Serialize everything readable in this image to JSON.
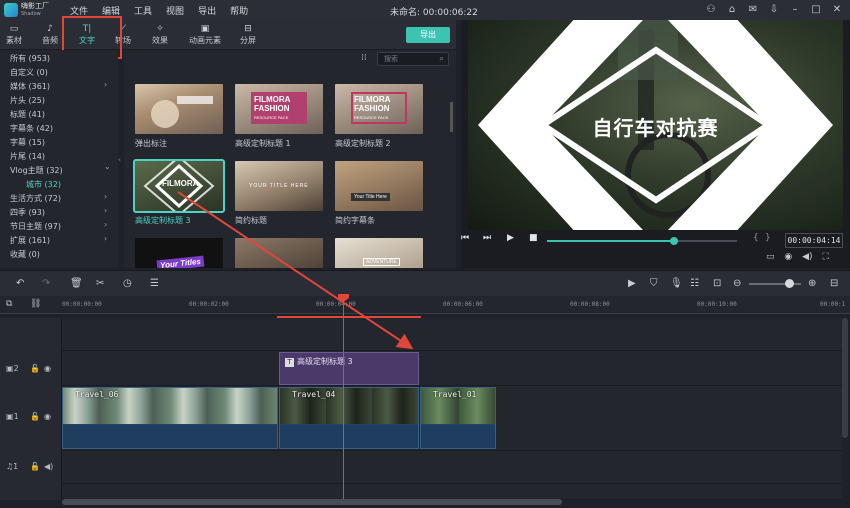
{
  "app": {
    "logo_line1": "嗨影工厂",
    "logo_line2": "Shadow",
    "doc_title": "未命名: 00:00:06:22",
    "menu": [
      "文件",
      "编辑",
      "工具",
      "视图",
      "导出",
      "帮助"
    ]
  },
  "tabs": [
    {
      "label": "素材",
      "icon": "folder-icon"
    },
    {
      "label": "音频",
      "icon": "music-icon"
    },
    {
      "label": "文字",
      "icon": "text-icon",
      "active": true
    },
    {
      "label": "转场",
      "icon": "transition-icon"
    },
    {
      "label": "效果",
      "icon": "effects-icon"
    },
    {
      "label": "动画元素",
      "icon": "image-icon"
    },
    {
      "label": "分屏",
      "icon": "split-screen-icon"
    }
  ],
  "export_label": "导出",
  "search_placeholder": "搜索",
  "sidebar": {
    "items": [
      {
        "label": "所有 (953)"
      },
      {
        "label": "自定义 (0)"
      },
      {
        "label": "媒体 (361)",
        "arrow": "›"
      },
      {
        "label": "片头 (25)"
      },
      {
        "label": "标题 (41)"
      },
      {
        "label": "字幕条 (42)"
      },
      {
        "label": "字幕 (15)"
      },
      {
        "label": "片尾 (14)"
      },
      {
        "label": "Vlog主题 (32)",
        "arrow": "⌄"
      },
      {
        "label": "城市 (32)",
        "sub": true
      },
      {
        "label": "生活方式 (72)",
        "arrow": "›"
      },
      {
        "label": "四季 (93)",
        "arrow": "›"
      },
      {
        "label": "节日主题 (97)",
        "arrow": "›"
      },
      {
        "label": "扩展 (161)",
        "arrow": "›"
      },
      {
        "label": "收藏 (0)"
      }
    ]
  },
  "thumbnails": [
    {
      "label": "弹出标注"
    },
    {
      "label": "高级定制标题 1",
      "text1": "FILMORA",
      "text2": "FASHION",
      "text3": "RESOURCE PACK"
    },
    {
      "label": "高级定制标题 2",
      "text1": "FILMORA",
      "text2": "FASHION",
      "text3": "RESOURCE PACK"
    },
    {
      "label": "高级定制标题 3",
      "text1": "FILMORA",
      "selected": true
    },
    {
      "label": "简约标题",
      "text1": "YOUR TITLE HERE"
    },
    {
      "label": "简约字幕条",
      "text1": "Your Title Here"
    },
    {
      "label": "",
      "text1": "Your Titles"
    },
    {
      "label": ""
    },
    {
      "label": "",
      "text1": "ADVENTURE"
    }
  ],
  "preview": {
    "title_text": "自行车对抗赛",
    "timecode": "00:00:04:14",
    "progress": 0.67
  },
  "ruler_labels": [
    "00:00:00:00",
    "00:00:02:00",
    "00:00:04:00",
    "00:00:06:00",
    "00:00:08:00",
    "00:00:10:00",
    "00:00:1"
  ],
  "tracks": {
    "title_track_num": "2",
    "video_track_num": "1",
    "audio_track_num": "1"
  },
  "clips": {
    "title_clip": "高级定制标题 3",
    "video_clips": [
      "Travel_06",
      "Travel_04",
      "Travel_01"
    ]
  },
  "colors": {
    "accent": "#3cc3b2",
    "annotation_red": "#e0463a",
    "title_clip": "#4a3a6a",
    "video_clip": "#244366"
  }
}
